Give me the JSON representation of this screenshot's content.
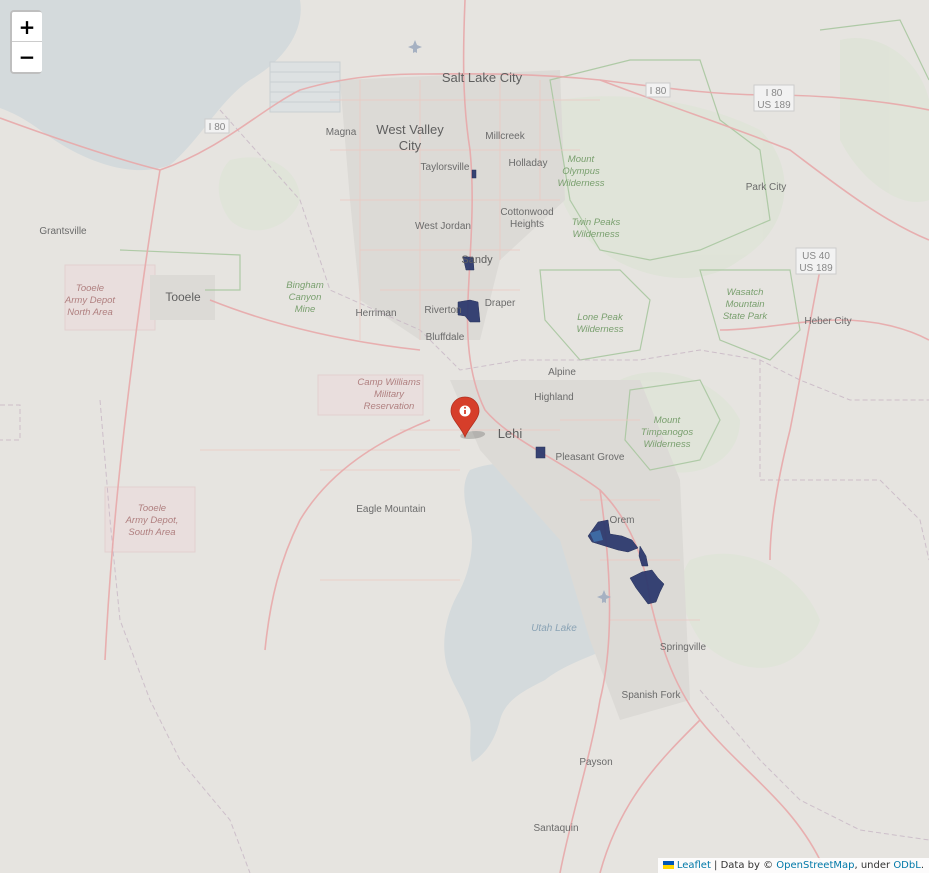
{
  "map": {
    "places": [
      {
        "id": "salt-lake-city",
        "label": "Salt Lake City"
      },
      {
        "id": "west-valley-city-1",
        "label": "West Valley"
      },
      {
        "id": "west-valley-city-2",
        "label": "City"
      },
      {
        "id": "magna",
        "label": "Magna"
      },
      {
        "id": "millcreek",
        "label": "Millcreek"
      },
      {
        "id": "holladay",
        "label": "Holladay"
      },
      {
        "id": "taylorsville",
        "label": "Taylorsville"
      },
      {
        "id": "cottonwood-1",
        "label": "Cottonwood"
      },
      {
        "id": "cottonwood-2",
        "label": "Heights"
      },
      {
        "id": "west-jordan",
        "label": "West Jordan"
      },
      {
        "id": "sandy",
        "label": "Sandy"
      },
      {
        "id": "grantsville",
        "label": "Grantsville"
      },
      {
        "id": "tooele",
        "label": "Tooele"
      },
      {
        "id": "herriman",
        "label": "Herriman"
      },
      {
        "id": "riverton",
        "label": "Riverton"
      },
      {
        "id": "draper",
        "label": "Draper"
      },
      {
        "id": "bluffdale",
        "label": "Bluffdale"
      },
      {
        "id": "alpine",
        "label": "Alpine"
      },
      {
        "id": "highland",
        "label": "Highland"
      },
      {
        "id": "lehi",
        "label": "Lehi"
      },
      {
        "id": "pleasant-grove",
        "label": "Pleasant Grove"
      },
      {
        "id": "eagle-mountain",
        "label": "Eagle Mountain"
      },
      {
        "id": "orem",
        "label": "Orem"
      },
      {
        "id": "springville",
        "label": "Springville"
      },
      {
        "id": "spanish-fork",
        "label": "Spanish Fork"
      },
      {
        "id": "payson",
        "label": "Payson"
      },
      {
        "id": "santaquin",
        "label": "Santaquin"
      },
      {
        "id": "park-city",
        "label": "Park City"
      },
      {
        "id": "heber-city",
        "label": "Heber City"
      }
    ],
    "parks": [
      {
        "id": "mount-olympus",
        "lines": [
          "Mount",
          "Olympus",
          "Wilderness"
        ]
      },
      {
        "id": "twin-peaks",
        "lines": [
          "Twin Peaks",
          "Wilderness"
        ]
      },
      {
        "id": "lone-peak",
        "lines": [
          "Lone Peak",
          "Wilderness"
        ]
      },
      {
        "id": "mount-timpanogos",
        "lines": [
          "Mount",
          "Timpanogos",
          "Wilderness"
        ]
      },
      {
        "id": "wasatch-mountain",
        "lines": [
          "Wasatch",
          "Mountain",
          "State Park"
        ]
      },
      {
        "id": "bingham-canyon",
        "lines": [
          "Bingham",
          "Canyon",
          "Mine"
        ]
      }
    ],
    "military": [
      {
        "id": "tooele-north",
        "lines": [
          "Tooele",
          "Army Depot",
          "North Area"
        ]
      },
      {
        "id": "tooele-south",
        "lines": [
          "Tooele",
          "Army Depot,",
          "South Area"
        ]
      },
      {
        "id": "camp-williams",
        "lines": [
          "Camp Williams",
          "Military",
          "Reservation"
        ]
      }
    ],
    "water_label": "Utah Lake",
    "shields": [
      {
        "id": "i80-west",
        "lines": [
          "I 80"
        ]
      },
      {
        "id": "i80-east",
        "lines": [
          "I 80"
        ]
      },
      {
        "id": "i80-us189",
        "lines": [
          "I 80",
          "US 189"
        ]
      },
      {
        "id": "us40-us189",
        "lines": [
          "US 40",
          "US 189"
        ]
      }
    ],
    "marker": {
      "icon": "info-circle-icon",
      "color": "#d63e2a"
    },
    "choropleth_color": "#2e3a6e"
  },
  "controls": {
    "zoom_in": "+",
    "zoom_out": "−"
  },
  "attribution": {
    "leaflet": "Leaflet",
    "sep1": " | Data by © ",
    "osm": "OpenStreetMap",
    "sep2": ", under ",
    "odbl": "ODbL",
    "end": "."
  }
}
